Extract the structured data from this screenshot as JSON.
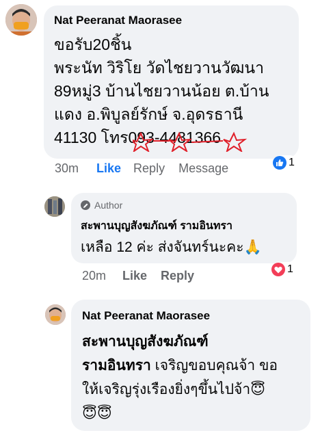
{
  "comment1": {
    "author": "Nat Peeranat Maorasee",
    "lines": [
      "ขอรับ20ชิ้น",
      "พระนัท วิริโย วัดไชยวานวัฒนา",
      "89หมู่3 บ้านไชยวานน้อย ต.บ้าน",
      "แดง อ.พิบูลย์รักษ์ จ.อุดรธานี",
      "41130 โทร093-4481366"
    ],
    "time": "30m",
    "like": "Like",
    "reply": "Reply",
    "message": "Message",
    "reaction_count": "1",
    "reaction_type": "like-icon"
  },
  "comment2": {
    "badge": "Author",
    "author": "สะพานบุญสังฆภัณฑ์ รามอินทรา",
    "text": "เหลือ 12 ค่ะ ส่งจันทร์นะคะ🙏",
    "time": "20m",
    "like": "Like",
    "reply": "Reply",
    "reaction_count": "1",
    "reaction_type": "love-icon"
  },
  "comment3": {
    "author": "Nat Peeranat Maorasee",
    "mention_line1": "สะพานบุญสังฆภัณฑ์",
    "mention_line2": "รามอินทรา",
    "text_after_mention": " เจริญขอบคุณจ้า ขอ",
    "line3": "ให้เจริญรุ่งเรืองยิ่งๆขึ้นไปจ้า😇",
    "line4": "😇😇"
  },
  "colors": {
    "bubble": "#f0f2f5",
    "like_blue": "#1877f2",
    "love_red": "#f33e58",
    "meta_gray": "#65676b"
  }
}
